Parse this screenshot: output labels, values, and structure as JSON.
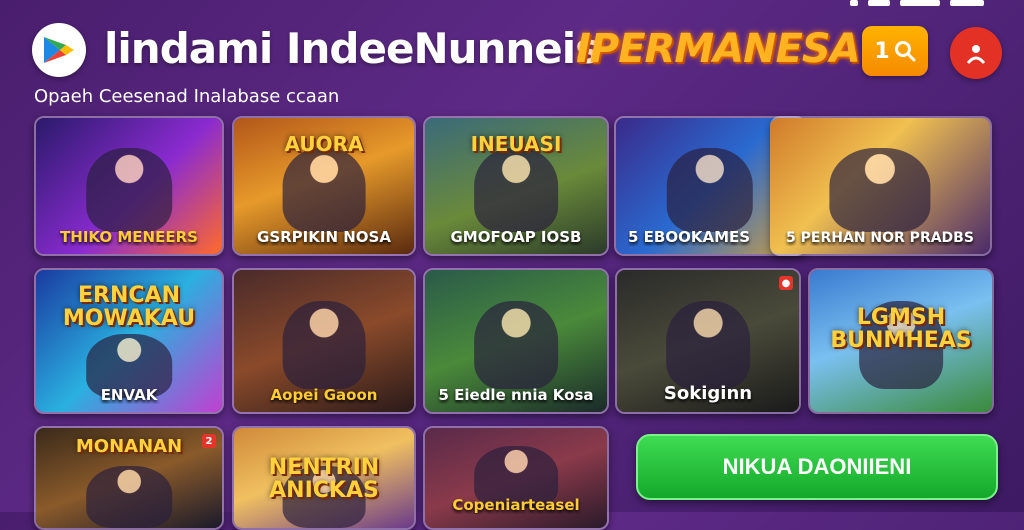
{
  "header": {
    "title": "lindami IndeeNunneis",
    "subtitle": "Opaeh Ceesenad Inalabase ccaan",
    "brand": "IPERMANESA",
    "search_label": "1"
  },
  "colors": {
    "brand": "#ffb321",
    "download": "#1fbf38",
    "profile": "#e43126"
  },
  "icons": {
    "logo": "play-store-icon",
    "search": "search-icon",
    "profile": "profile-icon"
  },
  "games": [
    {
      "headline": "",
      "label": "THIKO MENEERS",
      "badge": ""
    },
    {
      "headline": "AUORA",
      "label": "GSRPIKIN NOSA",
      "badge": ""
    },
    {
      "headline": "INEUASI",
      "label": "GMOFOAP IOSB",
      "badge": ""
    },
    {
      "headline": "",
      "label": "5 EBOOKAMES",
      "badge": ""
    },
    {
      "headline": "",
      "label": "5 PERHAN NOR PRADBS",
      "badge": ""
    },
    {
      "headline": "ERNCAN MOWAKAU",
      "label": "ENVAK",
      "badge": ""
    },
    {
      "headline": "",
      "label": "Aopei Gaoon",
      "badge": ""
    },
    {
      "headline": "",
      "label": "5 Eiedle nnia Kosa",
      "badge": ""
    },
    {
      "headline": "",
      "label": "Sokiginn",
      "badge": "●"
    },
    {
      "headline": "LGMSH BUNMHEAS",
      "label": "",
      "badge": ""
    },
    {
      "headline": "MONANAN",
      "label": "",
      "badge": "2"
    },
    {
      "headline": "NENTRIN ANICKAS",
      "label": "",
      "badge": ""
    },
    {
      "headline": "",
      "label": "Copeniarteasel",
      "badge": ""
    }
  ],
  "download_label": "NIKUA DAONIIENI"
}
